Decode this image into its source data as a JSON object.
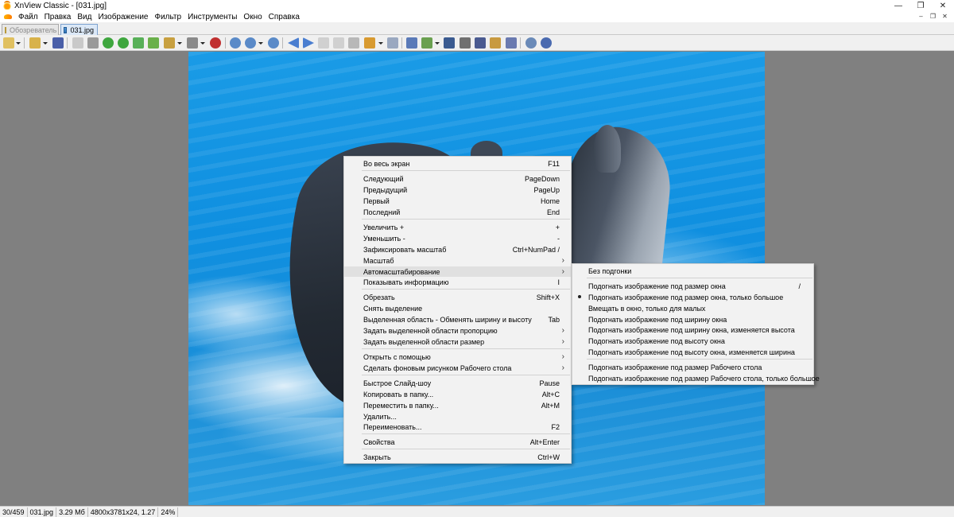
{
  "window": {
    "title": "XnView Classic - [031.jpg]"
  },
  "menubar": {
    "items": [
      "Файл",
      "Правка",
      "Вид",
      "Изображение",
      "Фильтр",
      "Инструменты",
      "Окно",
      "Справка"
    ]
  },
  "tabs": [
    {
      "label": "Обозреватель",
      "active": false
    },
    {
      "label": "031.jpg",
      "active": true
    }
  ],
  "toolbar": {
    "icons": [
      "layout-icon",
      "open-folder-icon",
      "save-icon",
      "print-preview-icon",
      "crop-icon",
      "rotate-left-icon",
      "rotate-right-icon",
      "adjust-icon",
      "export-icon",
      "batch-icon",
      "color-icon",
      "effects-icon",
      "zoom-in-icon",
      "zoom-icon",
      "zoom-out-icon",
      "prev-icon",
      "next-icon",
      "first-icon",
      "last-icon",
      "slideshow-icon",
      "screen-icon",
      "fullscreen-icon",
      "convert-icon",
      "binoculars-icon",
      "printer-icon",
      "scanner-icon",
      "wallpaper-icon",
      "capture-icon",
      "settings-icon",
      "info-icon"
    ]
  },
  "context_menu": {
    "items": [
      {
        "label": "Во весь экран",
        "shortcut": "F11"
      },
      {
        "label": "Следующий",
        "shortcut": "PageDown"
      },
      {
        "label": "Предыдущий",
        "shortcut": "PageUp"
      },
      {
        "label": "Первый",
        "shortcut": "Home"
      },
      {
        "label": "Последний",
        "shortcut": "End"
      },
      {
        "label": "Увеличить +",
        "shortcut": "+"
      },
      {
        "label": "Уменьшить -",
        "shortcut": "-"
      },
      {
        "label": "Зафиксировать масштаб",
        "shortcut": "Ctrl+NumPad /"
      },
      {
        "label": "Масштаб",
        "shortcut": ""
      },
      {
        "label": "Автомасштабирование",
        "shortcut": ""
      },
      {
        "label": "Показывать информацию",
        "shortcut": "I"
      },
      {
        "label": "Обрезать",
        "shortcut": "Shift+X"
      },
      {
        "label": "Снять выделение",
        "shortcut": ""
      },
      {
        "label": "Выделенная область - Обменять ширину и высоту",
        "shortcut": "Tab"
      },
      {
        "label": "Задать выделенной области пропорцию",
        "shortcut": ""
      },
      {
        "label": "Задать выделенной области размер",
        "shortcut": ""
      },
      {
        "label": "Открыть с помощью",
        "shortcut": ""
      },
      {
        "label": "Сделать фоновым рисунком Рабочего стола",
        "shortcut": ""
      },
      {
        "label": "Быстрое Слайд-шоу",
        "shortcut": "Pause"
      },
      {
        "label": "Копировать в папку...",
        "shortcut": "Alt+C"
      },
      {
        "label": "Переместить в папку...",
        "shortcut": "Alt+M"
      },
      {
        "label": "Удалить...",
        "shortcut": ""
      },
      {
        "label": "Переименовать...",
        "shortcut": "F2"
      },
      {
        "label": "Свойства",
        "shortcut": "Alt+Enter"
      },
      {
        "label": "Закрыть",
        "shortcut": "Ctrl+W"
      }
    ]
  },
  "submenu": {
    "items": [
      {
        "label": "Без подгонки",
        "shortcut": ""
      },
      {
        "label": "Подогнать изображение под размер окна",
        "shortcut": "/"
      },
      {
        "label": "Подогнать изображение под размер окна, только большое",
        "shortcut": ""
      },
      {
        "label": "Вмещать в окно, только для малых",
        "shortcut": ""
      },
      {
        "label": "Подогнать изображение под ширину окна",
        "shortcut": ""
      },
      {
        "label": "Подогнать изображение под ширину окна, изменяется высота",
        "shortcut": ""
      },
      {
        "label": "Подогнать изображение под высоту окна",
        "shortcut": ""
      },
      {
        "label": "Подогнать изображение под высоту окна, изменяется ширина",
        "shortcut": ""
      },
      {
        "label": "Подогнать изображение под размер Рабочего стола",
        "shortcut": ""
      },
      {
        "label": "Подогнать изображение под размер Рабочего стола, только большое",
        "shortcut": ""
      }
    ]
  },
  "statusbar": {
    "index": "30/459",
    "filename": "031.jpg",
    "filesize": "3.29 Мб",
    "dimensions": "4800x3781x24, 1.27",
    "zoom": "24%"
  },
  "colors": {
    "accent": "#0f8fe0",
    "menu_bg": "#f2f2f2",
    "highlight": "#e0e0e0"
  }
}
